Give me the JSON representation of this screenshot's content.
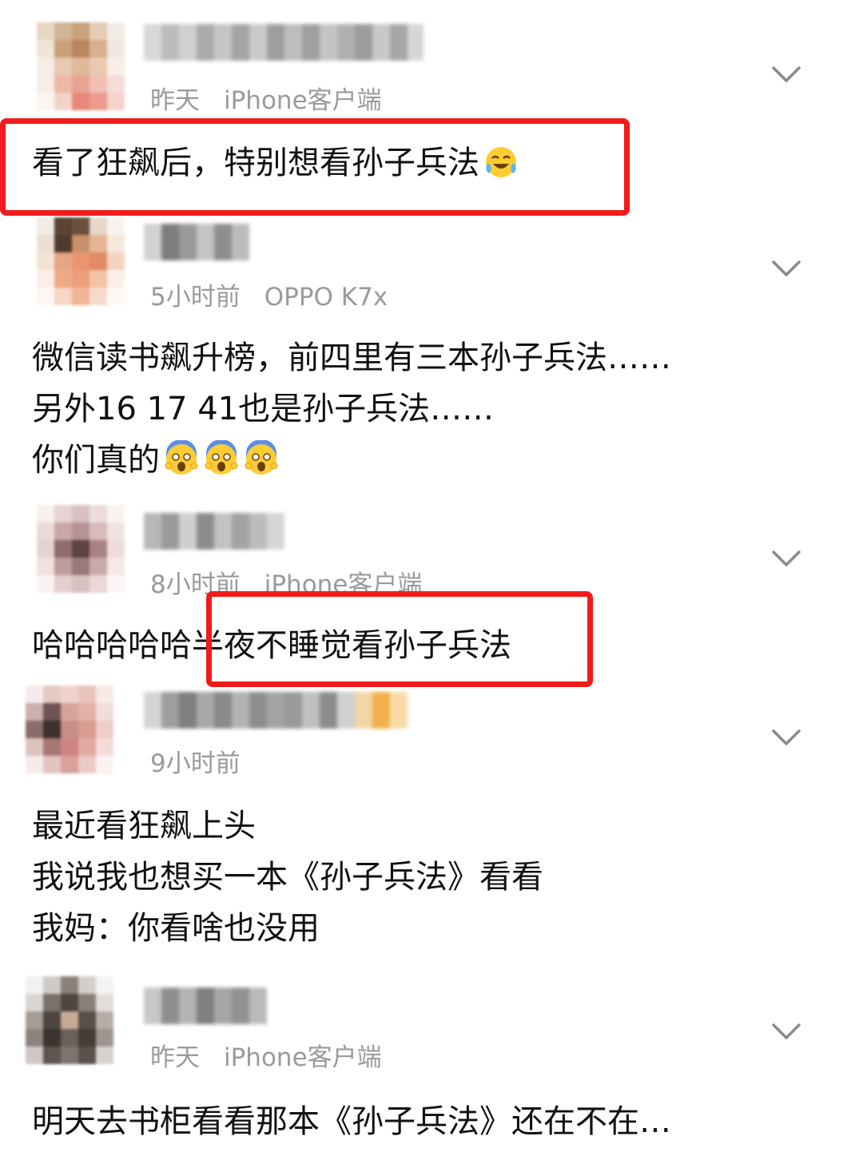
{
  "comments": [
    {
      "time": "昨天",
      "device": "iPhone客户端",
      "lines": [
        "看了狂飙后，特别想看孙子兵法"
      ],
      "emoji": "laugh-cry-emoji"
    },
    {
      "time": "5小时前",
      "device": "OPPO K7x",
      "lines": [
        "微信读书飙升榜，前四里有三本孙子兵法……",
        "另外16 17 41也是孙子兵法……",
        "你们真的"
      ],
      "emoji": "screaming-face-emoji"
    },
    {
      "time": "8小时前",
      "device": "iPhone客户端",
      "lines": [
        "哈哈哈哈哈半夜不睡觉看孙子兵法"
      ]
    },
    {
      "time": "9小时前",
      "device": "",
      "lines": [
        "最近看狂飙上头",
        "我说我也想买一本《孙子兵法》看看",
        "我妈：你看啥也没用"
      ]
    },
    {
      "time": "昨天",
      "device": "iPhone客户端",
      "lines": [
        "明天去书柜看看那本《孙子兵法》还在不在…"
      ]
    }
  ],
  "colors": {
    "highlight": "#f21b1b",
    "meta_text": "#9a9a9a",
    "body_text": "#111111"
  },
  "icons": {
    "expand": "chevron-down-icon"
  }
}
